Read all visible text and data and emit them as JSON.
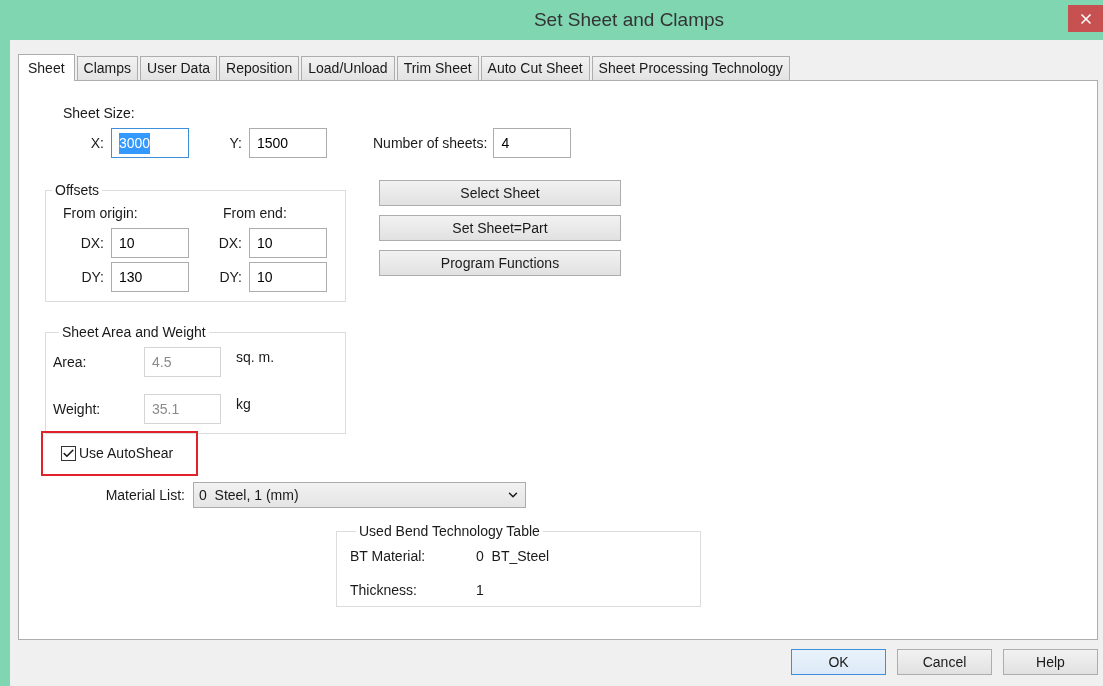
{
  "window": {
    "title": "Set Sheet and Clamps"
  },
  "tabs": [
    {
      "label": "Sheet",
      "selected": true
    },
    {
      "label": "Clamps",
      "selected": false
    },
    {
      "label": "User Data",
      "selected": false
    },
    {
      "label": "Reposition",
      "selected": false
    },
    {
      "label": "Load/Unload",
      "selected": false
    },
    {
      "label": "Trim Sheet",
      "selected": false
    },
    {
      "label": "Auto Cut Sheet",
      "selected": false
    },
    {
      "label": "Sheet Processing Technology",
      "selected": false
    }
  ],
  "sheet_size": {
    "label": "Sheet Size:",
    "fields": [
      {
        "label": "X:",
        "value": "3000",
        "focused": true
      },
      {
        "label": "Y:",
        "value": "1500",
        "focused": false
      }
    ]
  },
  "number_of_sheets": {
    "label": "Number of sheets:",
    "value": "4"
  },
  "offsets": {
    "title": "Offsets",
    "columns": [
      {
        "heading": "From origin:",
        "fields": [
          {
            "label": "DX:",
            "value": "10"
          },
          {
            "label": "DY:",
            "value": "130"
          }
        ]
      },
      {
        "heading": "From end:",
        "fields": [
          {
            "label": "DX:",
            "value": "10"
          },
          {
            "label": "DY:",
            "value": "10"
          }
        ]
      }
    ]
  },
  "actions": [
    "Select Sheet",
    "Set Sheet=Part",
    "Program Functions"
  ],
  "area_weight": {
    "title": "Sheet Area and Weight",
    "rows": [
      {
        "label": "Area:",
        "value": "4.5",
        "unit": "sq. m.",
        "disabled": true
      },
      {
        "label": "Weight:",
        "value": "35.1",
        "unit": "kg",
        "disabled": true
      }
    ]
  },
  "use_autoshear": {
    "label": "Use AutoShear",
    "checked": true,
    "highlighted": true
  },
  "material_list": {
    "label": "Material List:",
    "value": "0  Steel, 1 (mm)"
  },
  "bend_table": {
    "title": "Used Bend Technology Table",
    "rows": [
      {
        "label": "BT Material:",
        "value": "0  BT_Steel"
      },
      {
        "label": "Thickness:",
        "value": "1"
      }
    ]
  },
  "buttons": [
    {
      "label": "OK",
      "default": true
    },
    {
      "label": "Cancel",
      "default": false
    },
    {
      "label": "Help",
      "default": false
    }
  ]
}
